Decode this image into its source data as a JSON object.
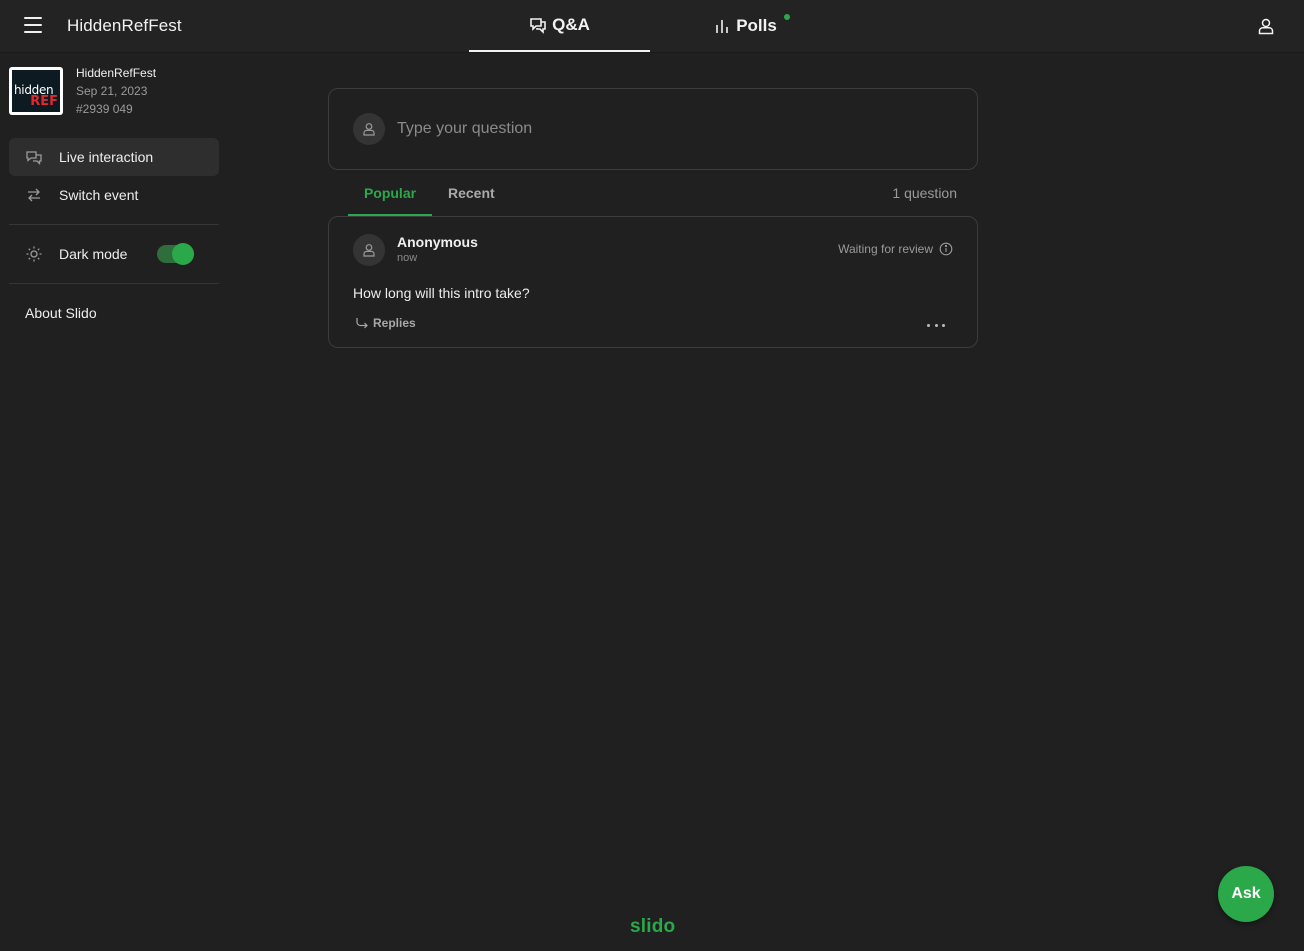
{
  "colors": {
    "background": "#202020",
    "accent": "#2aa84a",
    "text": "#e8e8e8",
    "muted": "#9a9a9a"
  },
  "header": {
    "menu_icon": "hamburger-icon",
    "app_title": "HiddenRefFest",
    "tabs": [
      {
        "label": "Q&A",
        "icon": "chat-bubbles-icon",
        "active": true
      },
      {
        "label": "Polls",
        "icon": "bar-chart-icon",
        "active": false,
        "has_notification": true
      }
    ],
    "user_icon": "user-icon"
  },
  "sidebar": {
    "event": {
      "logo_text_top": "hidden",
      "logo_text_bottom": "REF",
      "name": "HiddenRefFest",
      "date": "Sep 21, 2023",
      "code": "#2939 049"
    },
    "items": [
      {
        "label": "Live interaction",
        "icon": "chat-bubbles-icon",
        "active": true
      },
      {
        "label": "Switch event",
        "icon": "swap-arrows-icon",
        "active": false
      }
    ],
    "dark_mode": {
      "label": "Dark mode",
      "icon": "sun-icon",
      "enabled": true
    },
    "about_label": "About Slido"
  },
  "main": {
    "ask_placeholder": "Type your question",
    "subtabs": [
      {
        "label": "Popular",
        "active": true
      },
      {
        "label": "Recent",
        "active": false
      }
    ],
    "question_count": "1 question",
    "questions": [
      {
        "author": "Anonymous",
        "time": "now",
        "status": "Waiting for review",
        "text": "How long will this intro take?",
        "replies_label": "Replies"
      }
    ]
  },
  "ask_button_label": "Ask",
  "brand": "slido"
}
